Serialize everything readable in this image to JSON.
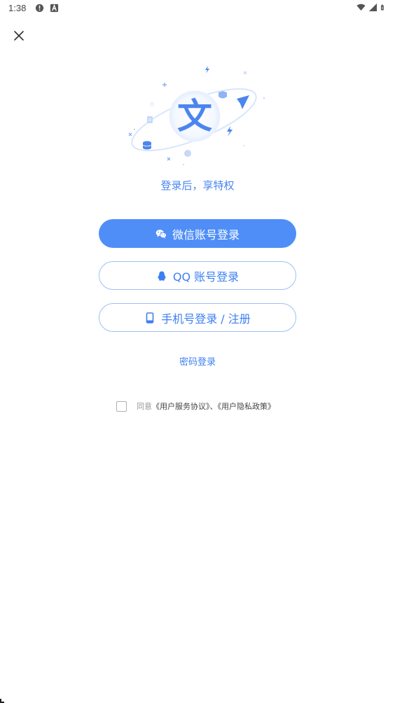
{
  "status_bar": {
    "time": "1:38",
    "left_icons": [
      "alert-circle-icon",
      "accessibility-icon"
    ],
    "right_icons": [
      "wifi-icon",
      "signal-icon",
      "battery-icon"
    ]
  },
  "header": {
    "close_icon": "close-icon"
  },
  "hero": {
    "glyph": "文"
  },
  "tagline": "登录后，享特权",
  "buttons": {
    "wechat_label": "微信账号登录",
    "qq_label": "QQ 账号登录",
    "phone_label": "手机号登录 / 注册"
  },
  "password_login": "密码登录",
  "agreement": {
    "prefix": "同意",
    "user_agreement": "《用户服务协议》",
    "separator": "、",
    "privacy_policy": "《用户隐私政策》",
    "checked": false
  },
  "colors": {
    "accent": "#4f8ef7",
    "link": "#3d7ff2",
    "outline_border": "#9fc0f5"
  }
}
